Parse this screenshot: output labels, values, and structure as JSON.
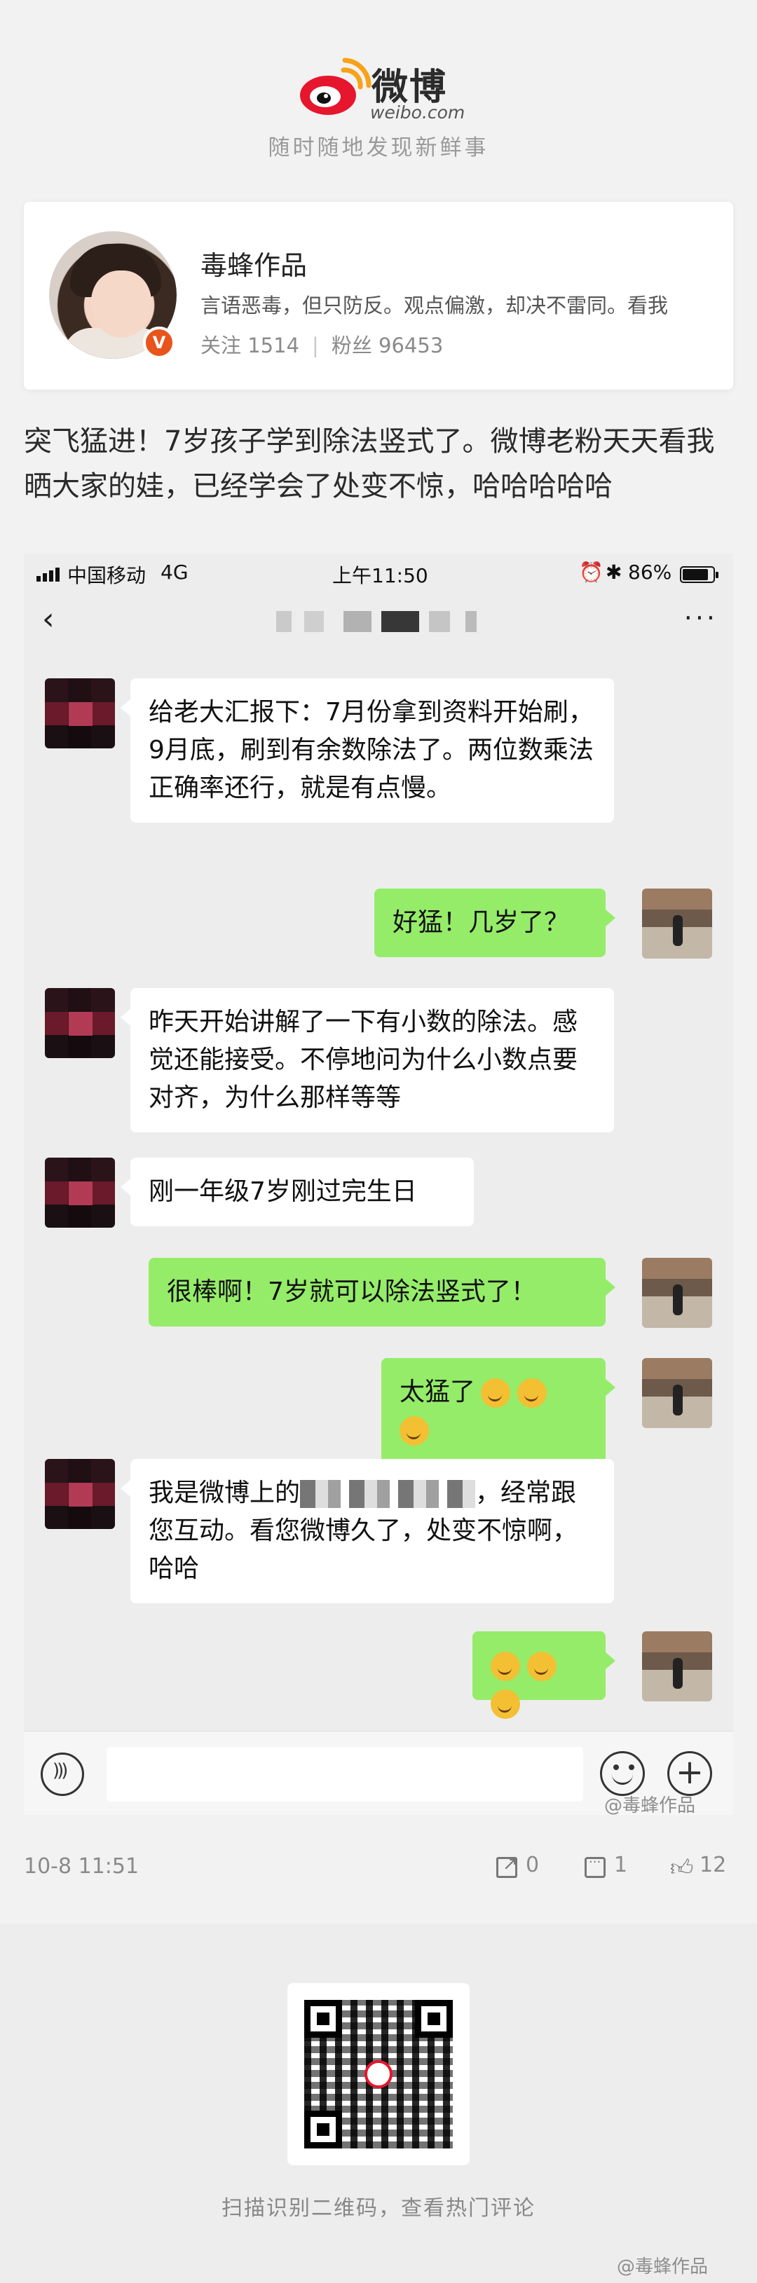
{
  "brand": {
    "name": "微博",
    "domain": "weibo.com",
    "slogan": "随时随地发现新鲜事"
  },
  "profile": {
    "name": "毒蜂作品",
    "bio": "言语恶毒，但只防反。观点偏激，却决不雷同。看我",
    "following_label": "关注 1514",
    "followers_label": "粉丝 96453",
    "verified_icon": "verified-badge-icon"
  },
  "post": {
    "text": "突飞猛进！7岁孩子学到除法竖式了。微博老粉天天看我晒大家的娃，已经学会了处变不惊，哈哈哈哈哈"
  },
  "chat": {
    "status_bar": {
      "carrier": "中国移动",
      "network": "4G",
      "time": "上午11:50",
      "battery": "86%",
      "battery_level": 0.86
    },
    "nav": {
      "back_icon": "‹",
      "more_icon": "···"
    },
    "messages": [
      {
        "side": "in",
        "text": "给老大汇报下：7月份拿到资料开始刷，9月底，刷到有余数除法了。两位数乘法正确率还行，就是有点慢。"
      },
      {
        "side": "out",
        "text": "好猛！几岁了？"
      },
      {
        "side": "in",
        "text": "昨天开始讲解了一下有小数的除法。感觉还能接受。不停地问为什么小数点要对齐，为什么那样等等"
      },
      {
        "side": "in",
        "text": "刚一年级7岁刚过完生日"
      },
      {
        "side": "out",
        "text": "很棒啊！7岁就可以除法竖式了！"
      },
      {
        "side": "out",
        "text": "太猛了"
      },
      {
        "side": "in",
        "text_before": "我是微博上的",
        "text_after": "，经常跟您互动。看您微博久了，处变不惊啊，哈哈"
      },
      {
        "side": "out",
        "text": ""
      }
    ],
    "input_placeholder": "",
    "watermark": "@毒蜂作品"
  },
  "meta": {
    "time": "10-8 11:51",
    "reposts": "0",
    "comments": "1",
    "likes": "12"
  },
  "footer": {
    "qr_caption": "扫描识别二维码，查看热门评论",
    "watermark": "@毒蜂作品"
  },
  "colors": {
    "accent": "#e6162d",
    "outgoing_bubble": "#95ec69",
    "incoming_bubble": "#ffffff",
    "chat_bg": "#ededed"
  }
}
